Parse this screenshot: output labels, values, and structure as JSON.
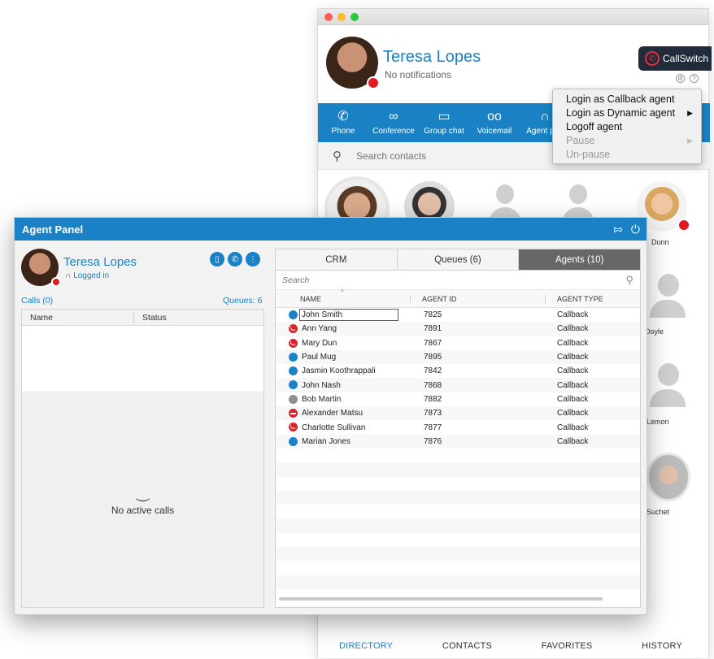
{
  "main_window": {
    "user_name": "Teresa Lopes",
    "notifications": "No notifications",
    "brand": "CallSwitch",
    "toolbar": [
      {
        "label": "Phone",
        "icon": "phone-icon"
      },
      {
        "label": "Conference",
        "icon": "conference-icon"
      },
      {
        "label": "Group chat",
        "icon": "chat-icon"
      },
      {
        "label": "Voicemail",
        "icon": "voicemail-icon"
      },
      {
        "label": "Agent pan",
        "icon": "headset-icon"
      }
    ],
    "search_placeholder": "Search contacts",
    "contact_names": [
      "Dunn",
      "Doyle",
      "Lemon",
      "Suchet"
    ],
    "bottom_tabs": [
      "DIRECTORY",
      "CONTACTS",
      "FAVORITES",
      "HISTORY"
    ]
  },
  "agent_menu": {
    "items": [
      {
        "label": "Login as Callback agent",
        "enabled": true
      },
      {
        "label": "Login as Dynamic agent",
        "enabled": true
      },
      {
        "label": "Logoff agent",
        "enabled": true
      },
      {
        "label": "Pause",
        "enabled": false
      },
      {
        "label": "Un-pause",
        "enabled": false
      }
    ]
  },
  "agent_panel": {
    "title": "Agent Panel",
    "user_name": "Teresa Lopes",
    "login_status": "Logged in",
    "calls_label": "Calls (0)",
    "queues_label": "Queues: 6",
    "calls_columns": [
      "Name",
      "Status"
    ],
    "no_calls_text": "No active calls",
    "tabs": [
      {
        "label": "CRM",
        "active": false
      },
      {
        "label": "Queues (6)",
        "active": false
      },
      {
        "label": "Agents (10)",
        "active": true
      }
    ],
    "search_placeholder": "Search",
    "agent_columns": [
      "NAME",
      "AGENT ID",
      "AGENT TYPE"
    ],
    "agents": [
      {
        "name": "John Smith",
        "id": "7825",
        "type": "Callback",
        "presence": "available",
        "color": "#1a82c4"
      },
      {
        "name": "Ann Yang",
        "id": "7891",
        "type": "Callback",
        "presence": "busy",
        "color": "#d9232c"
      },
      {
        "name": "Mary Dun",
        "id": "7867",
        "type": "Callback",
        "presence": "busy",
        "color": "#d9232c"
      },
      {
        "name": "Paul Mug",
        "id": "7895",
        "type": "Callback",
        "presence": "available",
        "color": "#1a82c4"
      },
      {
        "name": "Jasmin Koothrappali",
        "id": "7842",
        "type": "Callback",
        "presence": "available",
        "color": "#1a82c4"
      },
      {
        "name": "John Nash",
        "id": "7868",
        "type": "Callback",
        "presence": "available",
        "color": "#1a82c4"
      },
      {
        "name": "Bob Martin",
        "id": "7882",
        "type": "Callback",
        "presence": "offline",
        "color": "#8f8f8f"
      },
      {
        "name": "Alexander Matsu",
        "id": "7873",
        "type": "Callback",
        "presence": "dnd",
        "color": "#d9232c"
      },
      {
        "name": "Charlotte Sullivan",
        "id": "7877",
        "type": "Callback",
        "presence": "busy",
        "color": "#d9232c"
      },
      {
        "name": "Marian Jones",
        "id": "7876",
        "type": "Callback",
        "presence": "available",
        "color": "#1a82c4"
      }
    ]
  },
  "colors": {
    "accent": "#1a82c4",
    "busy": "#d9232c",
    "offline": "#8f8f8f",
    "active_tab": "#676767"
  }
}
